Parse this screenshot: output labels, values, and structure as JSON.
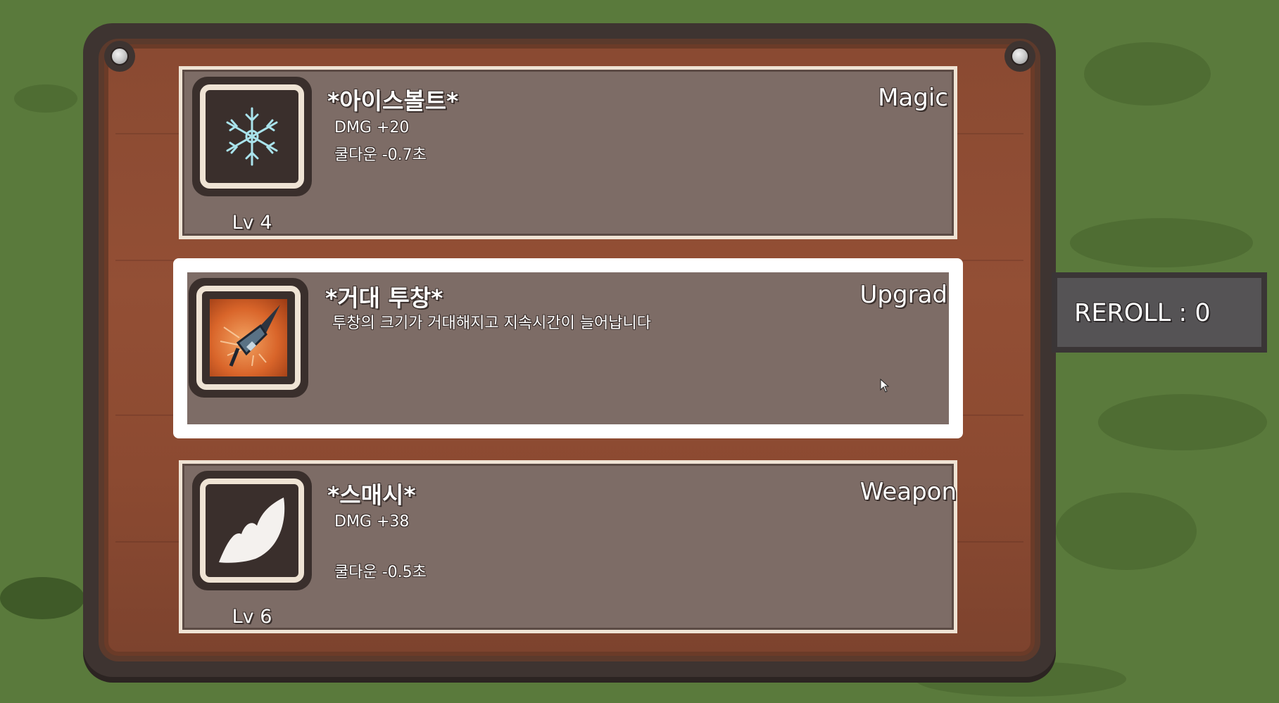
{
  "cards": [
    {
      "title": "*아이스볼트*",
      "type": "Magic",
      "stats": [
        "DMG  +20",
        "쿨다운  -0.7초"
      ],
      "level": "Lv 4",
      "icon": "snowflake-icon"
    },
    {
      "title": "*거대 투창*",
      "type": "Upgrad",
      "description": "투창의 크기가 거대해지고 지속시간이 늘어납니다",
      "icon": "javelin-icon"
    },
    {
      "title": "*스매시*",
      "type": "Weapon",
      "stats": [
        "DMG  +38",
        "쿨다운  -0.5초"
      ],
      "level": "Lv 6",
      "icon": "slash-icon"
    }
  ],
  "reroll": {
    "label": "REROLL : 0"
  },
  "colors": {
    "grass": "#5a7a3c",
    "wood": "#8a4a32",
    "card": "#7d6c66",
    "selected_border": "#ffffff",
    "reroll_bg": "#555355"
  }
}
